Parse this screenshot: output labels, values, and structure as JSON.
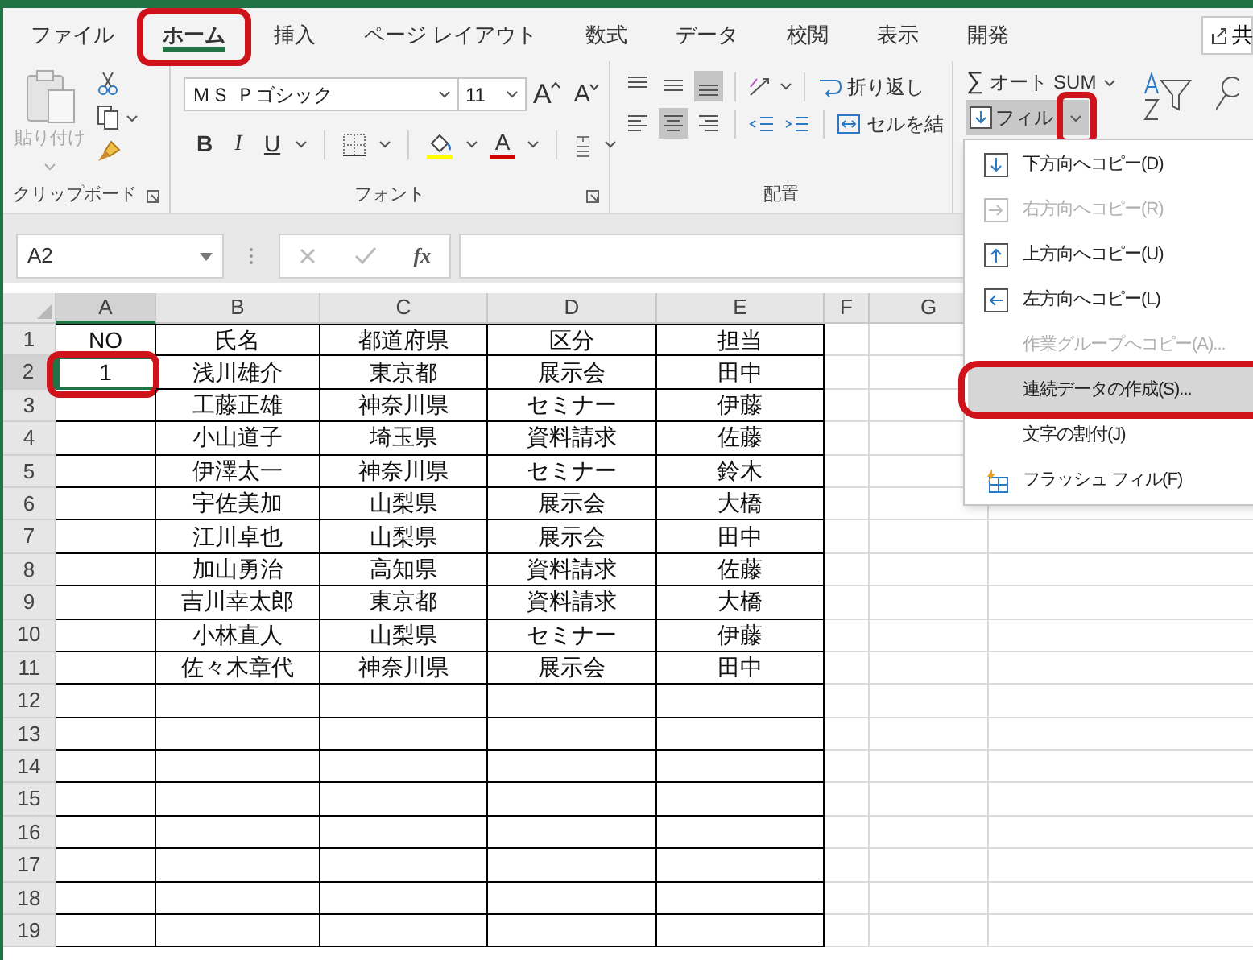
{
  "tabs": [
    {
      "label": "ファイル",
      "selected": false,
      "highlighted": false
    },
    {
      "label": "ホーム",
      "selected": true,
      "highlighted": true
    },
    {
      "label": "挿入",
      "selected": false,
      "highlighted": false
    },
    {
      "label": "ページ レイアウト",
      "selected": false,
      "highlighted": false
    },
    {
      "label": "数式",
      "selected": false,
      "highlighted": false
    },
    {
      "label": "データ",
      "selected": false,
      "highlighted": false
    },
    {
      "label": "校閲",
      "selected": false,
      "highlighted": false
    },
    {
      "label": "表示",
      "selected": false,
      "highlighted": false
    },
    {
      "label": "開発",
      "selected": false,
      "highlighted": false
    }
  ],
  "share_button": {
    "label": "共"
  },
  "ribbon": {
    "clipboard": {
      "paste": {
        "label": "貼り付け",
        "disabled": true
      },
      "group_label": "クリップボード"
    },
    "font": {
      "font_name": "ＭＳ Ｐゴシック",
      "font_size": "11",
      "grow": "A",
      "shrink": "A",
      "bold": "B",
      "italic": "I",
      "underline": "U",
      "font_color": "A",
      "group_label": "フォント"
    },
    "alignment": {
      "vertical": [
        {
          "kind": "top",
          "selected": false
        },
        {
          "kind": "middle",
          "selected": false
        },
        {
          "kind": "bottom",
          "selected": true
        }
      ],
      "horizontal": [
        {
          "kind": "left",
          "selected": false
        },
        {
          "kind": "center",
          "selected": true
        },
        {
          "kind": "right",
          "selected": false
        }
      ],
      "wrap_text": "折り返し",
      "merge": "セルを結",
      "group_label": "配置"
    },
    "editing": {
      "autosum_icon": "∑",
      "autosum": "オート SUM",
      "fill": "フィル",
      "fill_dropdown_highlighted": true
    }
  },
  "formula_bar": {
    "name_box": "A2",
    "function_label": "fx"
  },
  "grid": {
    "columns": [
      {
        "label": "A",
        "selected": true
      },
      {
        "label": "B",
        "selected": false
      },
      {
        "label": "C",
        "selected": false
      },
      {
        "label": "D",
        "selected": false
      },
      {
        "label": "E",
        "selected": false
      },
      {
        "label": "F",
        "selected": false
      },
      {
        "label": "G",
        "selected": false
      }
    ],
    "active_cell_highlighted": true,
    "rows": [
      {
        "number": "1",
        "selected": false,
        "cells": [
          "NO",
          "氏名",
          "都道府県",
          "区分",
          "担当"
        ]
      },
      {
        "number": "2",
        "selected": true,
        "cells": [
          "1",
          "浅川雄介",
          "東京都",
          "展示会",
          "田中"
        ]
      },
      {
        "number": "3",
        "selected": false,
        "cells": [
          "",
          "工藤正雄",
          "神奈川県",
          "セミナー",
          "伊藤"
        ]
      },
      {
        "number": "4",
        "selected": false,
        "cells": [
          "",
          "小山道子",
          "埼玉県",
          "資料請求",
          "佐藤"
        ]
      },
      {
        "number": "5",
        "selected": false,
        "cells": [
          "",
          "伊澤太一",
          "神奈川県",
          "セミナー",
          "鈴木"
        ]
      },
      {
        "number": "6",
        "selected": false,
        "cells": [
          "",
          "宇佐美加",
          "山梨県",
          "展示会",
          "大橋"
        ]
      },
      {
        "number": "7",
        "selected": false,
        "cells": [
          "",
          "江川卓也",
          "山梨県",
          "展示会",
          "田中"
        ]
      },
      {
        "number": "8",
        "selected": false,
        "cells": [
          "",
          "加山勇治",
          "高知県",
          "資料請求",
          "佐藤"
        ]
      },
      {
        "number": "9",
        "selected": false,
        "cells": [
          "",
          "吉川幸太郎",
          "東京都",
          "資料請求",
          "大橋"
        ]
      },
      {
        "number": "10",
        "selected": false,
        "cells": [
          "",
          "小林直人",
          "山梨県",
          "セミナー",
          "伊藤"
        ]
      },
      {
        "number": "11",
        "selected": false,
        "cells": [
          "",
          "佐々木章代",
          "神奈川県",
          "展示会",
          "田中"
        ]
      },
      {
        "number": "12",
        "selected": false
      },
      {
        "number": "13",
        "selected": false
      },
      {
        "number": "14",
        "selected": false
      },
      {
        "number": "15",
        "selected": false
      },
      {
        "number": "16",
        "selected": false
      },
      {
        "number": "17",
        "selected": false
      },
      {
        "number": "18",
        "selected": false
      },
      {
        "number": "19",
        "selected": false
      }
    ]
  },
  "fill_menu": [
    {
      "label": "下方向へコピー(D)",
      "kind": "down",
      "disabled": false,
      "selected": false,
      "highlighted": false
    },
    {
      "label": "右方向へコピー(R)",
      "kind": "right",
      "disabled": true,
      "selected": false,
      "highlighted": false
    },
    {
      "label": "上方向へコピー(U)",
      "kind": "up",
      "disabled": false,
      "selected": false,
      "highlighted": false
    },
    {
      "label": "左方向へコピー(L)",
      "kind": "left",
      "disabled": false,
      "selected": false,
      "highlighted": false
    },
    {
      "label": "作業グループへコピー(A)...",
      "disabled": true,
      "selected": false,
      "highlighted": false
    },
    {
      "label": "連続データの作成(S)...",
      "disabled": false,
      "selected": true,
      "highlighted": true
    },
    {
      "label": "文字の割付(J)",
      "disabled": false,
      "selected": false,
      "highlighted": false
    },
    {
      "label": "フラッシュ フィル(F)",
      "kind": "flash",
      "disabled": false,
      "selected": false,
      "highlighted": false
    }
  ]
}
